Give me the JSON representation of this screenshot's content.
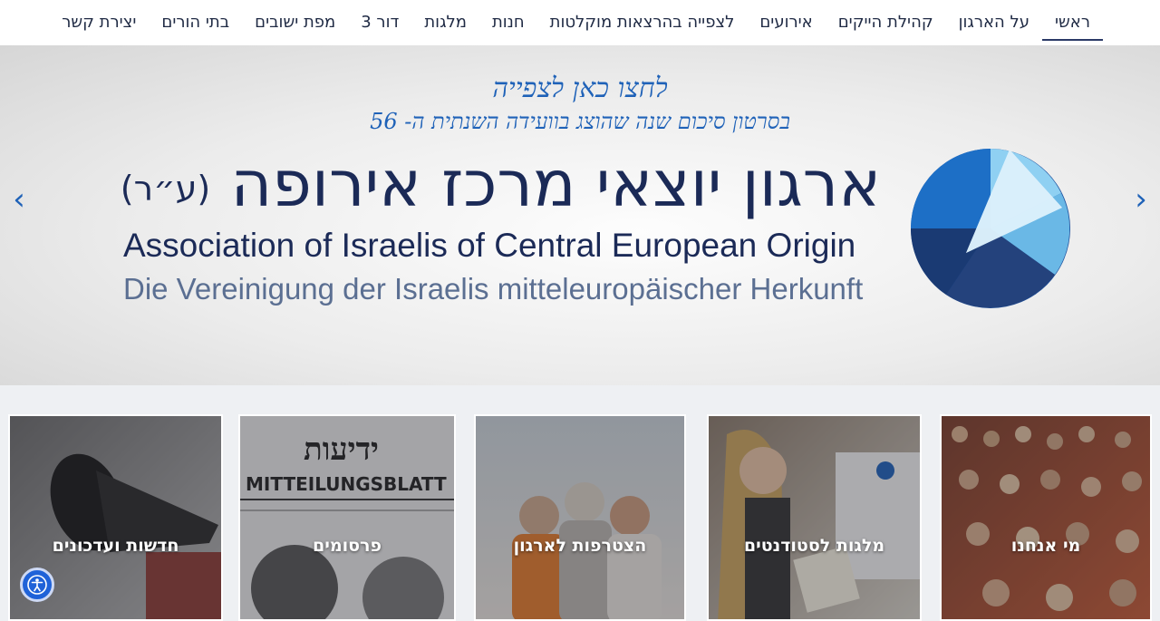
{
  "nav": {
    "items": [
      "ראשי",
      "על הארגון",
      "קהילת הייקים",
      "אירועים",
      "לצפייה בהרצאות מוקלטות",
      "חנות",
      "מלגות",
      "דור 3",
      "מפת ישובים",
      "בתי הורים",
      "יצירת קשר"
    ]
  },
  "hero": {
    "line1": "לחצו כאן לצפייה",
    "line2": "בסרטון סיכום שנה שהוצג בוועידה השנתית ה- 56",
    "org_hebrew": "ארגון יוצאי מרכז אירופה",
    "org_hebrew_abbr": "(ע״ר)",
    "org_english": "Association of Israelis of Central European Origin",
    "org_german": "Die Vereinigung der Israelis mitteleuropäischer Herkunft",
    "prev_icon": "chevron-left-icon",
    "next_icon": "chevron-right-icon"
  },
  "cards": [
    {
      "label": "חדשות ועדכונים",
      "icon": "megaphone"
    },
    {
      "label": "פרסומים",
      "icon": "newspaper"
    },
    {
      "label": "הצטרפות לארגון",
      "icon": "people"
    },
    {
      "label": "מלגות לסטודנטים",
      "icon": "speaker"
    },
    {
      "label": "מי אנחנו",
      "icon": "audience"
    }
  ],
  "accessibility": {
    "icon": "accessibility-icon"
  },
  "colors": {
    "accent": "#1f62b8",
    "nav_text": "#1f2a44",
    "dark_navy": "#1b2a57"
  }
}
